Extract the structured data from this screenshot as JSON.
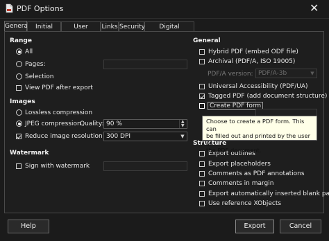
{
  "window": {
    "title": "PDF Options",
    "close_symbol": "✕"
  },
  "tabs": [
    {
      "label": "General",
      "active": true
    },
    {
      "label": "Initial View",
      "active": false
    },
    {
      "label": "User Interface",
      "active": false
    },
    {
      "label": "Links",
      "active": false
    },
    {
      "label": "Security",
      "active": false
    },
    {
      "label": "Digital Signatures",
      "active": false
    }
  ],
  "range": {
    "title": "Range",
    "all": "All",
    "pages": "Pages:",
    "selection": "Selection",
    "view_pdf_after_export": "View PDF after export"
  },
  "images": {
    "title": "Images",
    "lossless": "Lossless compression",
    "jpeg": "JPEG compression",
    "quality_label": "Quality:",
    "quality_value": "90 %",
    "reduce_resolution": "Reduce image resolution to:",
    "resolution_value": "300 DPI"
  },
  "watermark": {
    "title": "Watermark",
    "sign_with_watermark": "Sign with watermark"
  },
  "general": {
    "title": "General",
    "hybrid_pdf": "Hybrid PDF (embed ODF file)",
    "archival": "Archival (PDF/A, ISO 19005)",
    "pdfa_version_label": "PDF/A version:",
    "pdfa_version_value": "PDF/A-3b",
    "universal_accessibility": "Universal Accessibility (PDF/UA)",
    "tagged_pdf": "Tagged PDF (add document structure)",
    "create_pdf_form": "Create PDF form"
  },
  "tooltip": {
    "line1": "Choose to create a PDF form. This can",
    "line2": "be filled out and printed by the user of",
    "line3": "the PDF document."
  },
  "structure": {
    "title": "Structure",
    "export_outlines": "Export outlines",
    "export_placeholders": "Export placeholders",
    "comments_as_annotations": "Comments as PDF annotations",
    "comments_in_margin": "Comments in margin",
    "export_blank_pages": "Export automatically inserted blank pages",
    "use_reference_xobjects": "Use reference XObjects"
  },
  "buttons": {
    "help": "Help",
    "export": "Export",
    "cancel": "Cancel"
  },
  "colors": {
    "background": "#1b1b1b",
    "tooltip_bg": "#ffffe8",
    "text": "#e8e8e8"
  }
}
